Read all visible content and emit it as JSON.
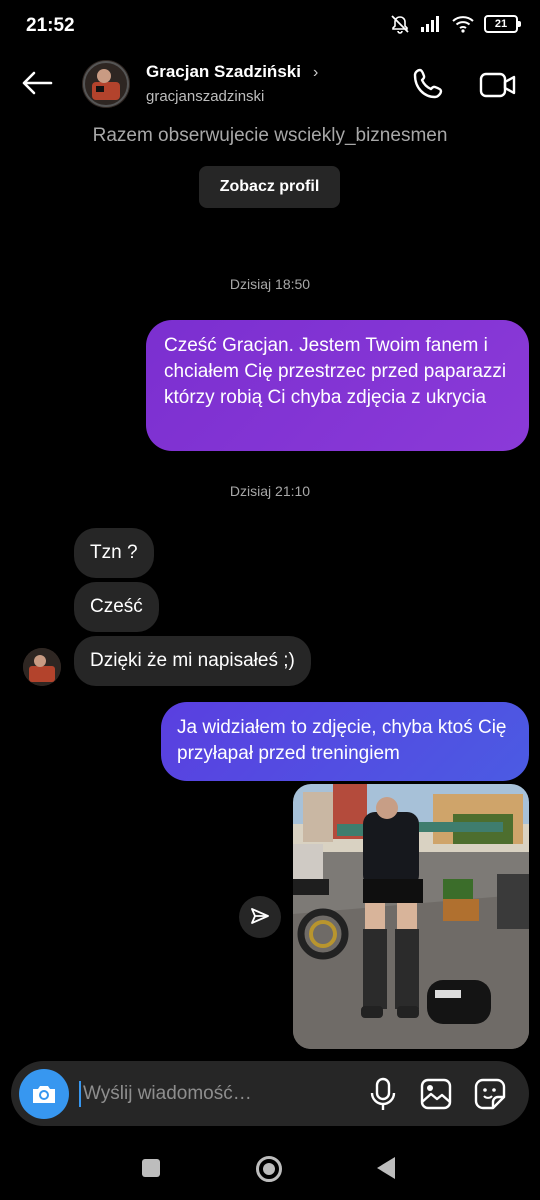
{
  "status_bar": {
    "time": "21:52",
    "battery": "21",
    "icons": [
      "mute-icon",
      "signal-icon",
      "wifi-icon",
      "battery-icon"
    ]
  },
  "header": {
    "name": "Gracjan Szadziński",
    "username": "gracjanszadzinski",
    "icons": [
      "back-arrow-icon",
      "chevron-right-icon",
      "phone-icon",
      "video-camera-icon"
    ]
  },
  "profile_card": {
    "mutual_text": "Razem obserwujecie wsciekly_biznesmen",
    "view_profile_label": "Zobacz profil"
  },
  "messages": {
    "timestamp_1": "Dzisiaj 18:50",
    "out_1": "Cześć Gracjan. Jestem Twoim fanem i chciałem Cię przestrzec przed paparazzi którzy robią Ci chyba zdjęcia z ukrycia",
    "timestamp_2": "Dzisiaj 21:10",
    "in_1": "Tzn ?",
    "in_2": "Cześć",
    "in_3": "Dzięki że mi napisałeś ;)",
    "out_2": "Ja widziałem to zdjęcie, chyba ktoś Cię przyłapał przed treningiem"
  },
  "composer": {
    "placeholder": "Wyślij wiadomość…",
    "icons": [
      "camera-icon",
      "microphone-icon",
      "gallery-icon",
      "sticker-icon"
    ]
  },
  "colors": {
    "background": "#000000",
    "incoming_bubble": "#262626",
    "outgoing_purple": "#7b2fd0",
    "outgoing_blue": "#4b5be3",
    "accent": "#3797f0",
    "secondary_text": "#a8a8a8"
  }
}
